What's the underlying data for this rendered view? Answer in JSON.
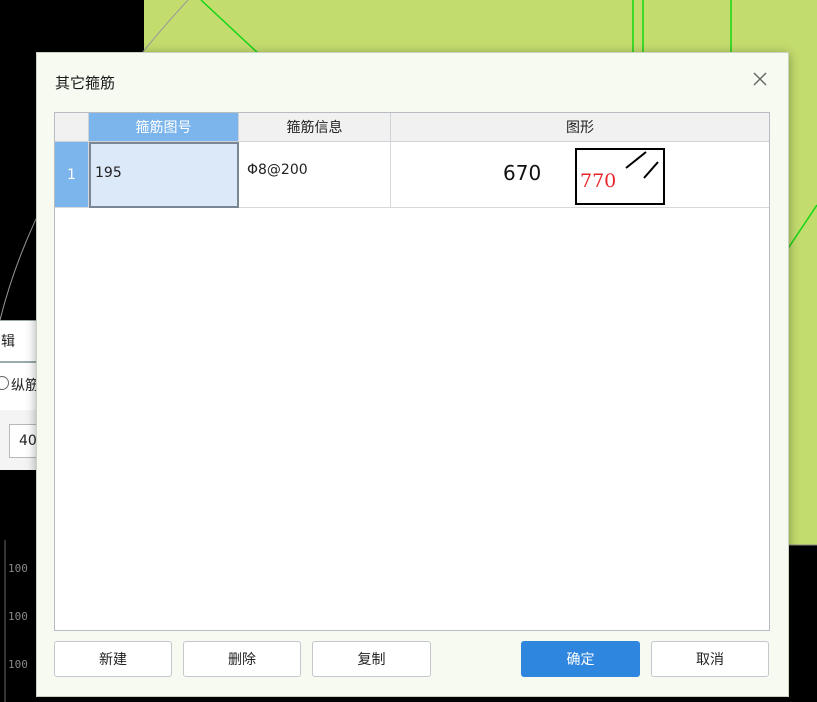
{
  "background": {
    "panel_title_fragment": "辑",
    "radio_label_fragment": "纵筋",
    "input_value_fragment": "40",
    "side_labels": [
      "100",
      "100",
      "100"
    ]
  },
  "dialog": {
    "title": "其它箍筋",
    "close_glyph": "✕",
    "table": {
      "columns": [
        "箍筋图号",
        "箍筋信息",
        "图形"
      ],
      "rows": [
        {
          "index": "1",
          "figure_no": "195",
          "info": "Φ8@200",
          "dim_left": "670",
          "dim_box": "770"
        }
      ]
    },
    "buttons": {
      "new": "新建",
      "delete": "删除",
      "copy": "复制",
      "ok": "确定",
      "cancel": "取消"
    },
    "colors": {
      "accent": "#2e86de",
      "header_selected": "#7cb4ec",
      "dimension_red": "#e8232a"
    }
  }
}
